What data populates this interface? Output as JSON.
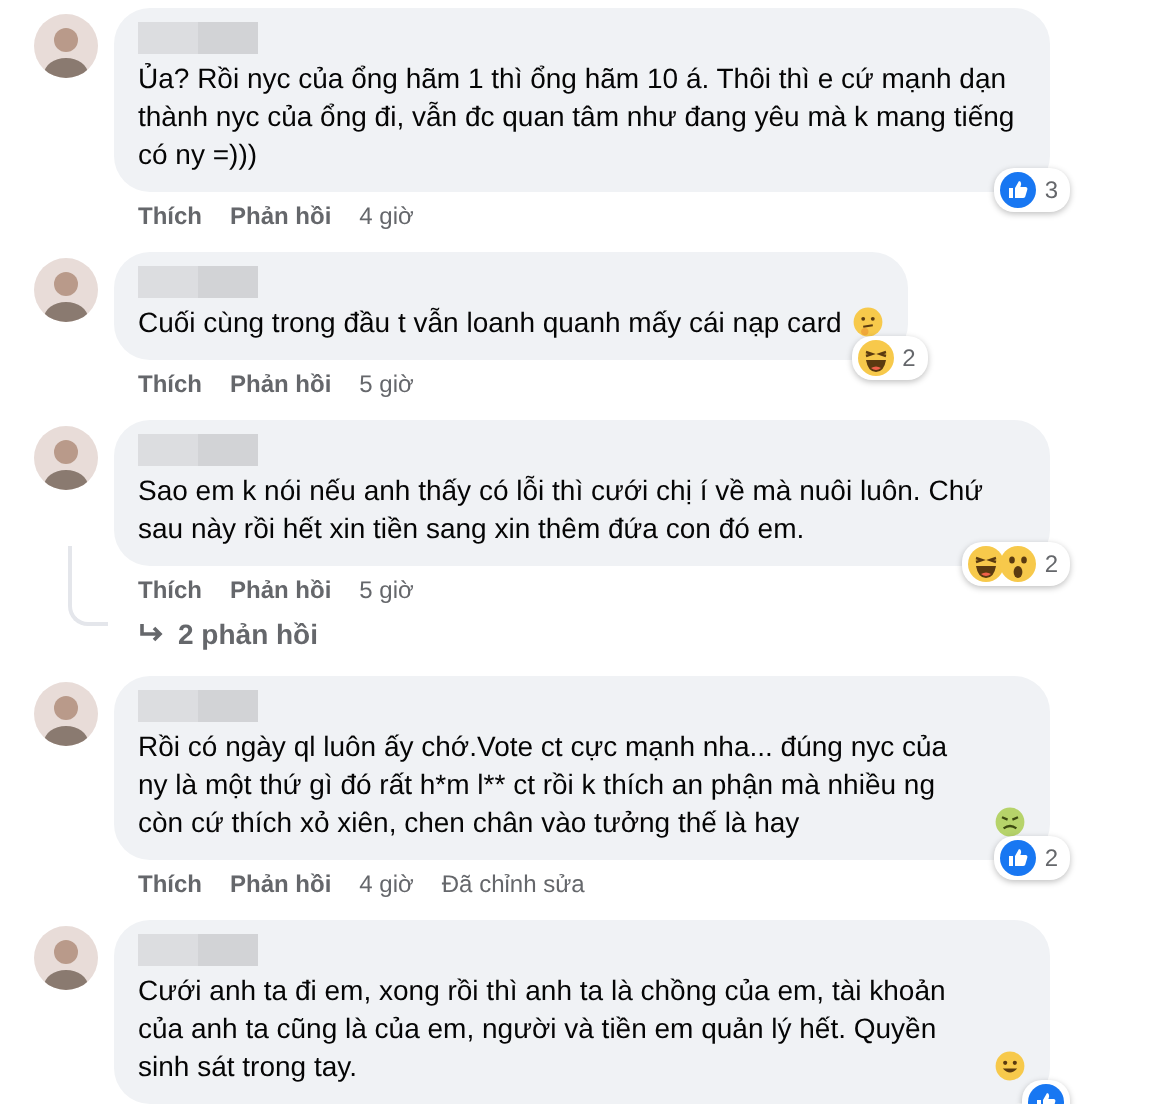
{
  "comments": [
    {
      "text": "Ủa? Rồi nyc của ổng hãm 1 thì ổng hãm 10 á. Thôi thì e cứ mạnh dạn thành nyc của ổng đi, vẫn đc quan tâm như đang yêu mà k mang tiếng có ny =)))",
      "reactions": [
        {
          "kind": "like"
        }
      ],
      "reaction_count": "3",
      "actions": {
        "like": "Thích",
        "reply": "Phản hồi",
        "time": "4 giờ"
      }
    },
    {
      "text": "Cuối cùng trong đầu t vẫn loanh quanh mấy cái nạp card",
      "emoji": {
        "kind": "thinking"
      },
      "reactions": [
        {
          "kind": "haha"
        }
      ],
      "reaction_count": "2",
      "actions": {
        "like": "Thích",
        "reply": "Phản hồi",
        "time": "5 giờ"
      }
    },
    {
      "text": "Sao em k nói nếu anh thấy có lỗi thì cưới chị í về mà nuôi luôn. Chứ sau này rồi hết xin tiền sang xin thêm đứa con đó em.",
      "reactions": [
        {
          "kind": "haha"
        },
        {
          "kind": "wow"
        }
      ],
      "reaction_count": "2",
      "actions": {
        "like": "Thích",
        "reply": "Phản hồi",
        "time": "5 giờ"
      },
      "replies_link": "2 phản hồi"
    },
    {
      "text": "Rồi có ngày ql luôn ấy chớ.Vote ct cực mạnh nha... đúng nyc của ny là một thứ gì đó rất h*m l** ct rồi k thích an phận mà nhiều ng còn cứ thích xỏ xiên, chen chân vào tưởng thế là hay",
      "emoji": {
        "kind": "sick"
      },
      "reactions": [
        {
          "kind": "like"
        }
      ],
      "reaction_count": "2",
      "actions": {
        "like": "Thích",
        "reply": "Phản hồi",
        "time": "4 giờ",
        "edited": "Đã chỉnh sửa"
      }
    },
    {
      "text": "Cưới anh ta đi em, xong rồi thì anh ta là chồng của em, tài khoản của anh ta cũng là của em, người và tiền em quản lý hết. Quyền sinh sát trong tay.",
      "emoji": {
        "kind": "smile"
      },
      "reactions": [
        {
          "kind": "like"
        }
      ]
    }
  ]
}
